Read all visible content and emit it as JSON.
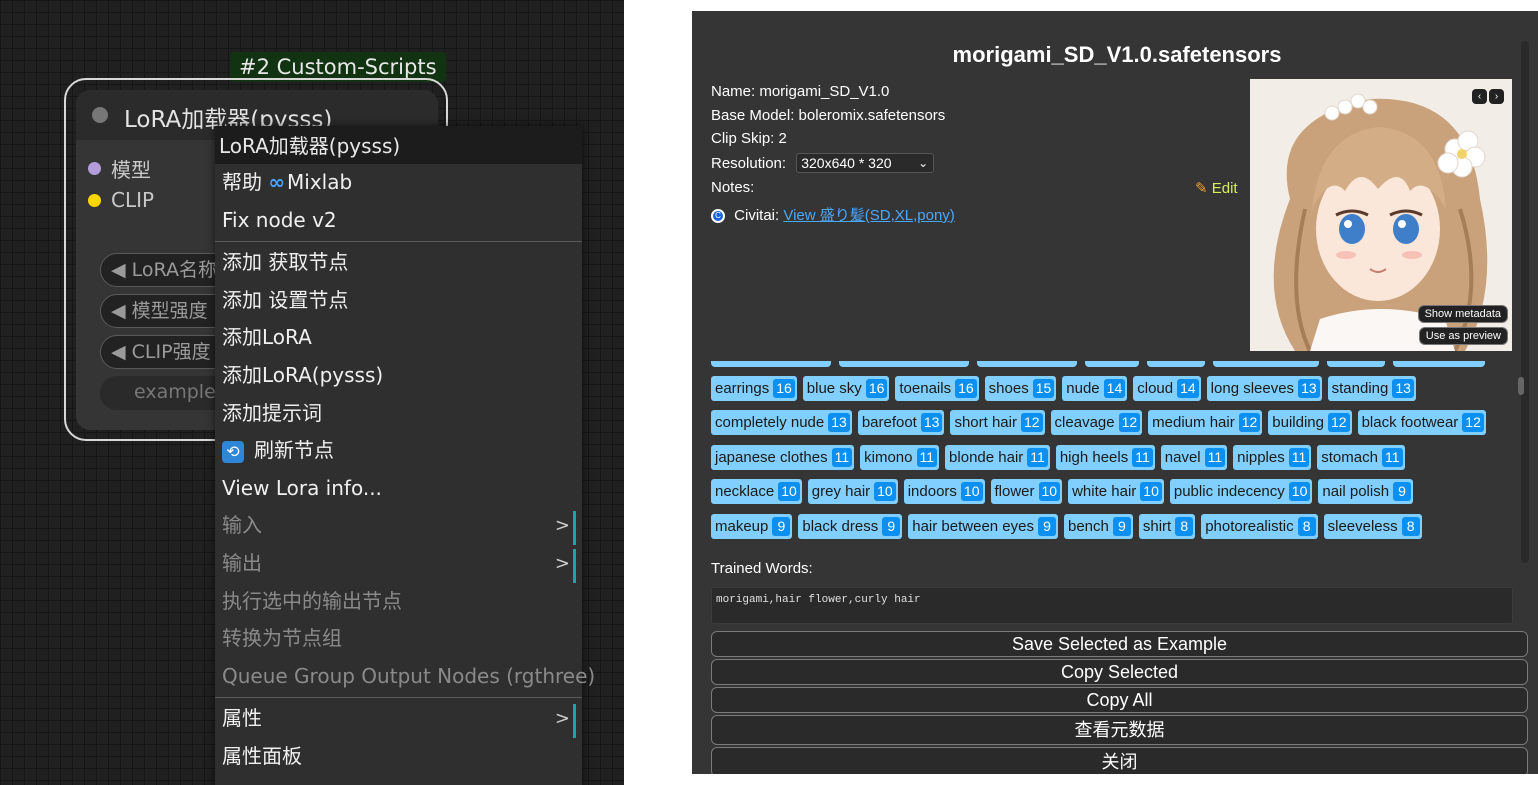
{
  "canvas": {
    "node_badge": "#2 Custom-Scripts",
    "node": {
      "title": "LoRA加载器(pysss)",
      "inputs": [
        {
          "label": "模型",
          "color": "#b39ddb"
        },
        {
          "label": "CLIP",
          "color": "#ffd500"
        }
      ],
      "widgets": [
        "◀ LoRA名称",
        "◀ 模型强度",
        "◀ CLIP强度"
      ],
      "example_placeholder": "example"
    },
    "context_menu": {
      "title": "LoRA加载器(pysss)",
      "group1": [
        {
          "label": "帮助",
          "extra": "Mixlab",
          "icon": "mixlab-icon"
        },
        {
          "label": "Fix node v2"
        }
      ],
      "group2": [
        {
          "label": "添加 获取节点"
        },
        {
          "label": "添加 设置节点"
        },
        {
          "label": "添加LoRA"
        },
        {
          "label": "添加LoRA(pysss)"
        },
        {
          "label": "添加提示词"
        },
        {
          "label": "刷新节点",
          "icon": "refresh-icon"
        },
        {
          "label": "View Lora info..."
        },
        {
          "label": "输入",
          "disabled": true,
          "submenu": true
        },
        {
          "label": "输出",
          "disabled": true,
          "submenu": true
        },
        {
          "label": "执行选中的输出节点",
          "disabled": true
        },
        {
          "label": "转换为节点组",
          "disabled": true
        },
        {
          "label": "Queue Group Output Nodes (rgthree)",
          "disabled": true
        }
      ],
      "group3": [
        {
          "label": "属性",
          "submenu": true
        },
        {
          "label": "属性面板"
        }
      ]
    }
  },
  "dialog": {
    "title": "morigami_SD_V1.0.safetensors",
    "name_line": "Name: morigami_SD_V1.0",
    "base_model_line": "Base Model: boleromix.safetensors",
    "clip_skip_line": "Clip Skip: 2",
    "resolution_label": "Resolution:",
    "resolution_value": "320x640 * 320",
    "notes_label": "Notes:",
    "edit_label": "Edit",
    "civitai_label": "Civitai:",
    "civitai_link": "View 盛り髪(SD,XL,pony)",
    "preview": {
      "prev_icon": "‹",
      "next_icon": "›",
      "show_metadata": "Show metadata",
      "use_as_preview": "Use as preview"
    },
    "tag_rows": [
      [
        {
          "tag": "earrings",
          "count": "16"
        },
        {
          "tag": "blue sky",
          "count": "16"
        },
        {
          "tag": "toenails",
          "count": "16"
        },
        {
          "tag": "shoes",
          "count": "15"
        },
        {
          "tag": "nude",
          "count": "14"
        },
        {
          "tag": "cloud",
          "count": "14"
        },
        {
          "tag": "long sleeves",
          "count": "13"
        },
        {
          "tag": "standing",
          "count": "13"
        }
      ],
      [
        {
          "tag": "completely nude",
          "count": "13"
        },
        {
          "tag": "barefoot",
          "count": "13"
        },
        {
          "tag": "short hair",
          "count": "12"
        },
        {
          "tag": "cleavage",
          "count": "12"
        },
        {
          "tag": "medium hair",
          "count": "12"
        },
        {
          "tag": "building",
          "count": "12"
        },
        {
          "tag": "black footwear",
          "count": "12"
        }
      ],
      [
        {
          "tag": "japanese clothes",
          "count": "11"
        },
        {
          "tag": "kimono",
          "count": "11"
        },
        {
          "tag": "blonde hair",
          "count": "11"
        },
        {
          "tag": "high heels",
          "count": "11"
        },
        {
          "tag": "navel",
          "count": "11"
        },
        {
          "tag": "nipples",
          "count": "11"
        },
        {
          "tag": "stomach",
          "count": "11"
        }
      ],
      [
        {
          "tag": "necklace",
          "count": "10"
        },
        {
          "tag": "grey hair",
          "count": "10"
        },
        {
          "tag": "indoors",
          "count": "10"
        },
        {
          "tag": "flower",
          "count": "10"
        },
        {
          "tag": "white hair",
          "count": "10"
        },
        {
          "tag": "public indecency",
          "count": "10"
        },
        {
          "tag": "nail polish",
          "count": "9"
        }
      ],
      [
        {
          "tag": "makeup",
          "count": "9"
        },
        {
          "tag": "black dress",
          "count": "9"
        },
        {
          "tag": "hair between eyes",
          "count": "9"
        },
        {
          "tag": "bench",
          "count": "9"
        },
        {
          "tag": "shirt",
          "count": "8"
        },
        {
          "tag": "photorealistic",
          "count": "8"
        },
        {
          "tag": "sleeveless",
          "count": "8"
        }
      ]
    ],
    "trained_words_label": "Trained Words:",
    "trained_words_value": "morigami,hair flower,curly hair",
    "buttons": [
      "Save Selected as Example",
      "Copy Selected",
      "Copy All",
      "查看元数据",
      "关闭"
    ]
  }
}
